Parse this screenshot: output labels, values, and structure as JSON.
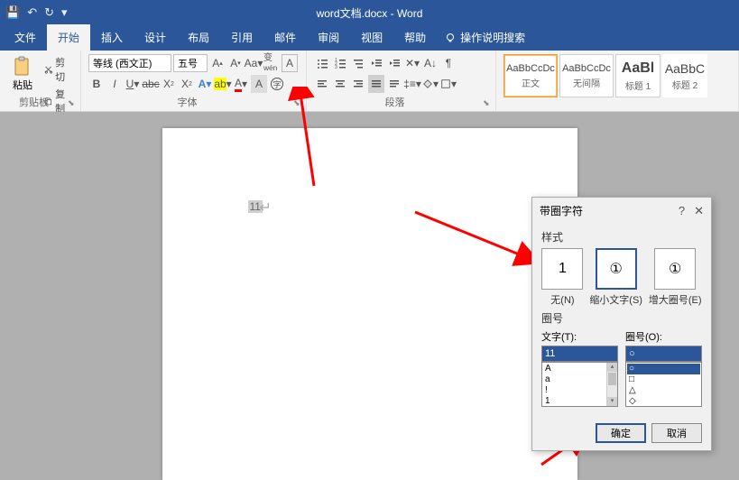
{
  "titlebar": {
    "title": "word文档.docx - Word"
  },
  "tabs": {
    "items": [
      "文件",
      "开始",
      "插入",
      "设计",
      "布局",
      "引用",
      "邮件",
      "审阅",
      "视图",
      "帮助"
    ],
    "tell_me": "操作说明搜索"
  },
  "ribbon": {
    "clipboard": {
      "paste": "粘贴",
      "cut": "剪切",
      "copy": "复制",
      "format_painter": "格式刷",
      "label": "剪贴板"
    },
    "font": {
      "name": "等线 (西文正)",
      "size": "五号",
      "label": "字体"
    },
    "paragraph": {
      "label": "段落"
    },
    "styles": {
      "items": [
        {
          "preview": "AaBbCcDc",
          "name": "正文"
        },
        {
          "preview": "AaBbCcDc",
          "name": "无间隔"
        },
        {
          "preview": "AaBl",
          "name": "标题 1"
        },
        {
          "preview": "AaBbC",
          "name": "标题 2"
        }
      ]
    }
  },
  "page": {
    "selected_text": "11"
  },
  "dialog": {
    "title": "带圈字符",
    "style_label": "样式",
    "opts": {
      "none": {
        "glyph": "1",
        "label": "无(N)"
      },
      "shrink": {
        "glyph": "①",
        "label": "缩小文字(S)"
      },
      "enlarge": {
        "glyph": "①",
        "label": "增大圈号(E)"
      }
    },
    "enclosure_label": "圈号",
    "text_label": "文字(T):",
    "ring_label": "圈号(O):",
    "text_value": "11",
    "text_list": [
      "A",
      "a",
      "!",
      "1"
    ],
    "ring_value": "○",
    "ring_list": [
      "○",
      "□",
      "△",
      "◇"
    ],
    "ok": "确定",
    "cancel": "取消"
  }
}
